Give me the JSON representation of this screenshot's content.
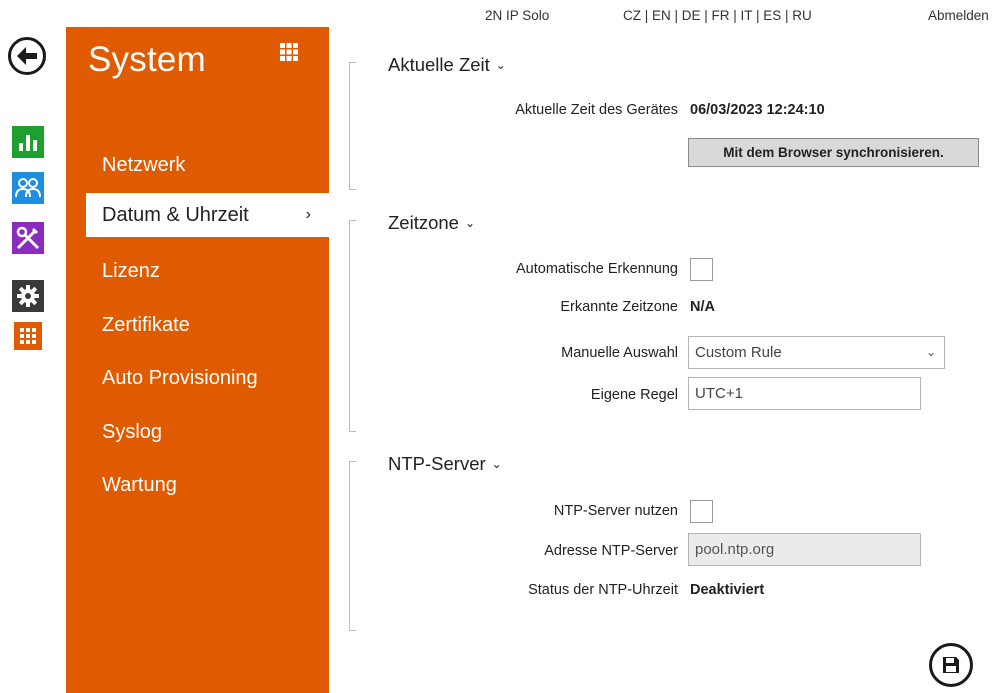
{
  "topbar": {
    "device": "2N IP Solo",
    "languages": "CZ | EN | DE | FR | IT | ES | RU",
    "logout": "Abmelden"
  },
  "rail": {
    "icons": [
      "back-icon",
      "statistics-icon",
      "users-icon",
      "tools-icon",
      "gear-icon",
      "apps-grid-icon"
    ],
    "colors": {
      "statistics": "#1fa02e",
      "users": "#1f8de0",
      "tools": "#8a2dbf",
      "gear": "#3a3a3a",
      "apps": "#e05a00"
    }
  },
  "sidebar": {
    "title": "System",
    "accent": "#e05a00",
    "items": [
      {
        "label": "Netzwerk"
      },
      {
        "label": "Datum & Uhrzeit",
        "active": true
      },
      {
        "label": "Lizenz"
      },
      {
        "label": "Zertifikate"
      },
      {
        "label": "Auto Provisioning"
      },
      {
        "label": "Syslog"
      },
      {
        "label": "Wartung"
      }
    ]
  },
  "current_time": {
    "title": "Aktuelle Zeit",
    "device_time_label": "Aktuelle Zeit des Gerätes",
    "device_time_value": "06/03/2023 12:24:10",
    "sync_button": "Mit dem Browser synchronisieren."
  },
  "timezone": {
    "title": "Zeitzone",
    "auto_detect_label": "Automatische Erkennung",
    "auto_detect_checked": false,
    "detected_label": "Erkannte Zeitzone",
    "detected_value": "N/A",
    "manual_label": "Manuelle Auswahl",
    "manual_value": "Custom Rule",
    "custom_label": "Eigene Regel",
    "custom_value": "UTC+1"
  },
  "ntp": {
    "title": "NTP-Server",
    "use_label": "NTP-Server nutzen",
    "use_checked": false,
    "address_label": "Adresse NTP-Server",
    "address_value": "pool.ntp.org",
    "status_label": "Status der NTP-Uhrzeit",
    "status_value": "Deaktiviert"
  }
}
